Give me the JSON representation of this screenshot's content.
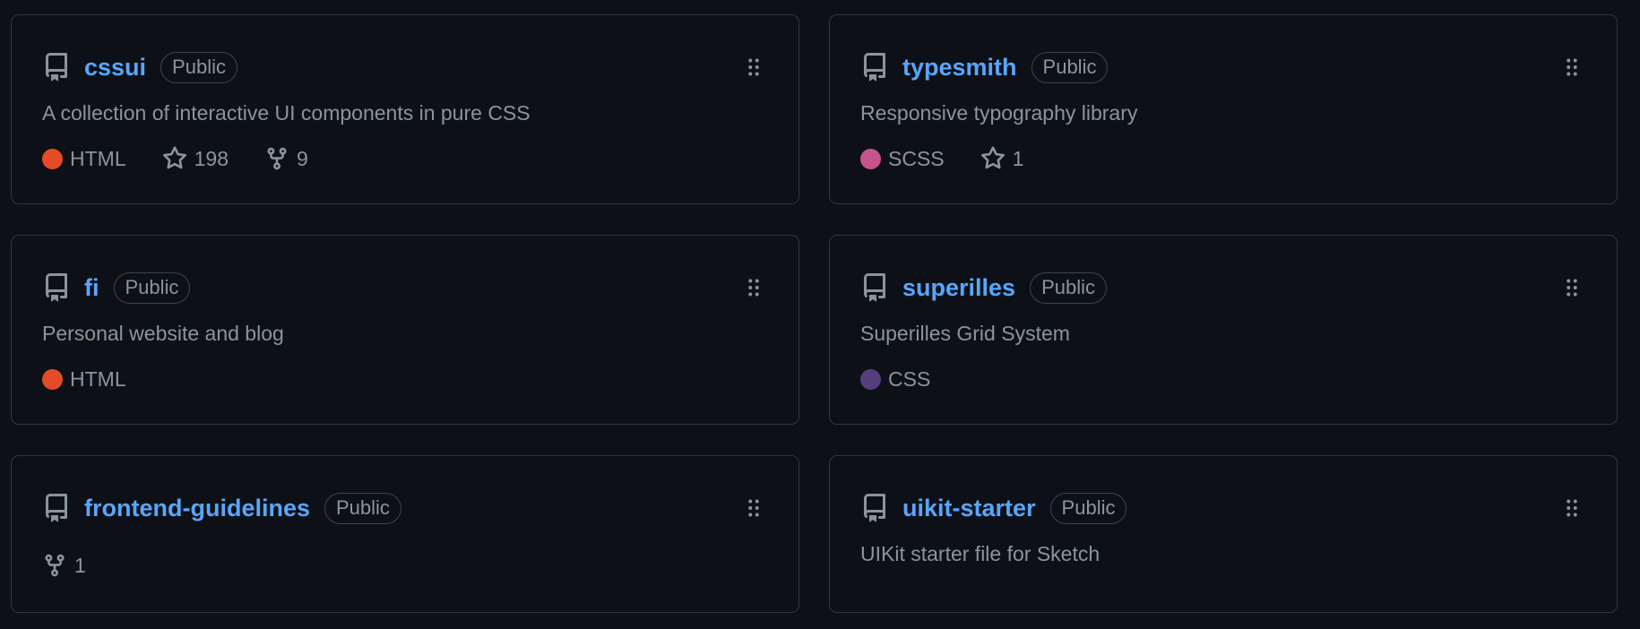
{
  "cards": [
    {
      "name": "cssui",
      "visibility": "Public",
      "description": "A collection of interactive UI components in pure CSS",
      "language": "HTML",
      "language_color": "#e34c26",
      "stars": "198",
      "forks": "9"
    },
    {
      "name": "typesmith",
      "visibility": "Public",
      "description": "Responsive typography library",
      "language": "SCSS",
      "language_color": "#c6538c",
      "stars": "1"
    },
    {
      "name": "fi",
      "visibility": "Public",
      "description": "Personal website and blog",
      "language": "HTML",
      "language_color": "#e34c26"
    },
    {
      "name": "superilles",
      "visibility": "Public",
      "description": "Superilles Grid System",
      "language": "CSS",
      "language_color": "#563d7c"
    },
    {
      "name": "frontend-guidelines",
      "visibility": "Public",
      "forks": "1"
    },
    {
      "name": "uikit-starter",
      "visibility": "Public",
      "description": "UIKit starter file for Sketch"
    }
  ],
  "icons": {
    "repo": "repo-icon",
    "drag": "grabber-icon",
    "star": "star-icon",
    "fork": "fork-icon"
  },
  "colors": {
    "background": "#0d1117",
    "border": "#30363d",
    "link": "#58a6ff",
    "muted_text": "#8b949e"
  }
}
